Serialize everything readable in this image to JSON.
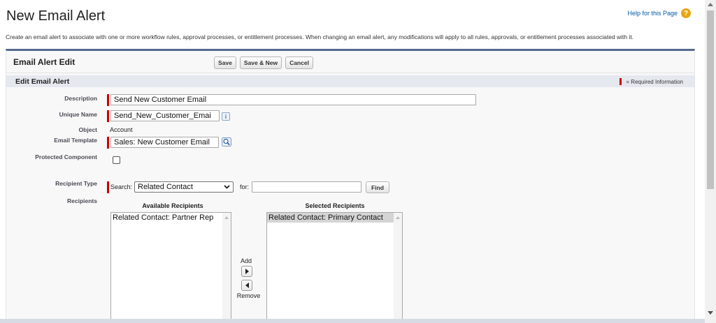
{
  "header": {
    "title": "New Email Alert",
    "help_link": "Help for this Page",
    "intro": "Create an email alert to associate with one or more workflow rules, approval processes, or entitlement processes. When changing an email alert, any modifications will apply to all rules, approvals, or entitlement processes associated with it."
  },
  "panel": {
    "title": "Email Alert Edit",
    "buttons": {
      "save": "Save",
      "save_new": "Save & New",
      "cancel": "Cancel"
    }
  },
  "section": {
    "title": "Edit Email Alert",
    "required_note": "= Required Information"
  },
  "fields": {
    "description": {
      "label": "Description",
      "value": "Send New Customer Email"
    },
    "unique_name": {
      "label": "Unique Name",
      "value": "Send_New_Customer_Emai"
    },
    "object": {
      "label": "Object",
      "value": "Account"
    },
    "email_template": {
      "label": "Email Template",
      "value": "Sales: New Customer Email"
    },
    "protected_component": {
      "label": "Protected Component",
      "checked": false
    },
    "recipient_type": {
      "label": "Recipient Type",
      "search_label": "Search:",
      "search_value": "Related Contact",
      "for_label": "for:",
      "for_value": "",
      "find_button": "Find"
    },
    "recipients": {
      "label": "Recipients",
      "available_header": "Available Recipients",
      "selected_header": "Selected Recipients",
      "available": [
        "Related Contact: Partner Rep"
      ],
      "selected": [
        "Related Contact: Primary Contact"
      ],
      "add_label": "Add",
      "remove_label": "Remove"
    }
  },
  "colors": {
    "required": "#cc0000",
    "panel_border": "#566a8c",
    "section_bg": "#e5e8ef",
    "help_icon": "#e8a614"
  },
  "icons": {
    "help": "question-circle-icon",
    "info": "info-icon",
    "lookup": "magnifier-lookup-icon",
    "add": "arrow-right-icon",
    "remove": "arrow-left-icon"
  }
}
